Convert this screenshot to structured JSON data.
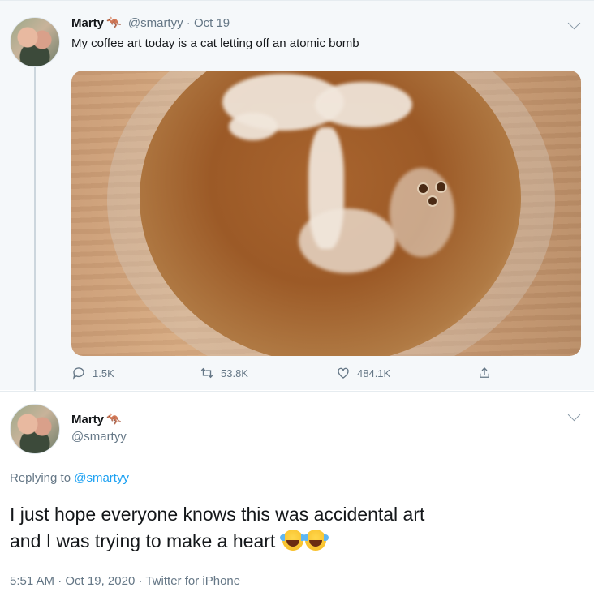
{
  "tweet1": {
    "name": "Marty",
    "handle": "@smartyy",
    "separator": "·",
    "date": "Oct 19",
    "text": "My coffee art today is a cat letting off an atomic bomb",
    "kangaroo_emoji": "🦘",
    "stats": {
      "replies": "1.5K",
      "retweets": "53.8K",
      "likes": "484.1K"
    }
  },
  "tweet2": {
    "name": "Marty",
    "handle": "@smartyy",
    "kangaroo_emoji": "🦘",
    "replying_label": "Replying to",
    "replying_to": "@smartyy",
    "text_line1": "I just hope everyone knows this was accidental art",
    "text_line2": "and I was trying to make a heart",
    "time": "5:51 AM",
    "separator": "·",
    "date": "Oct 19, 2020",
    "source": "Twitter for iPhone"
  },
  "icons": {
    "reply": "speech-bubble",
    "retweet": "retweet-arrows",
    "like": "heart",
    "share": "share-upload",
    "menu": "chevron-down",
    "laughing": "face-with-tears-of-joy"
  },
  "colors": {
    "link": "#1da1f2",
    "secondary_text": "#657786",
    "thread_background": "#f5f8fa"
  }
}
